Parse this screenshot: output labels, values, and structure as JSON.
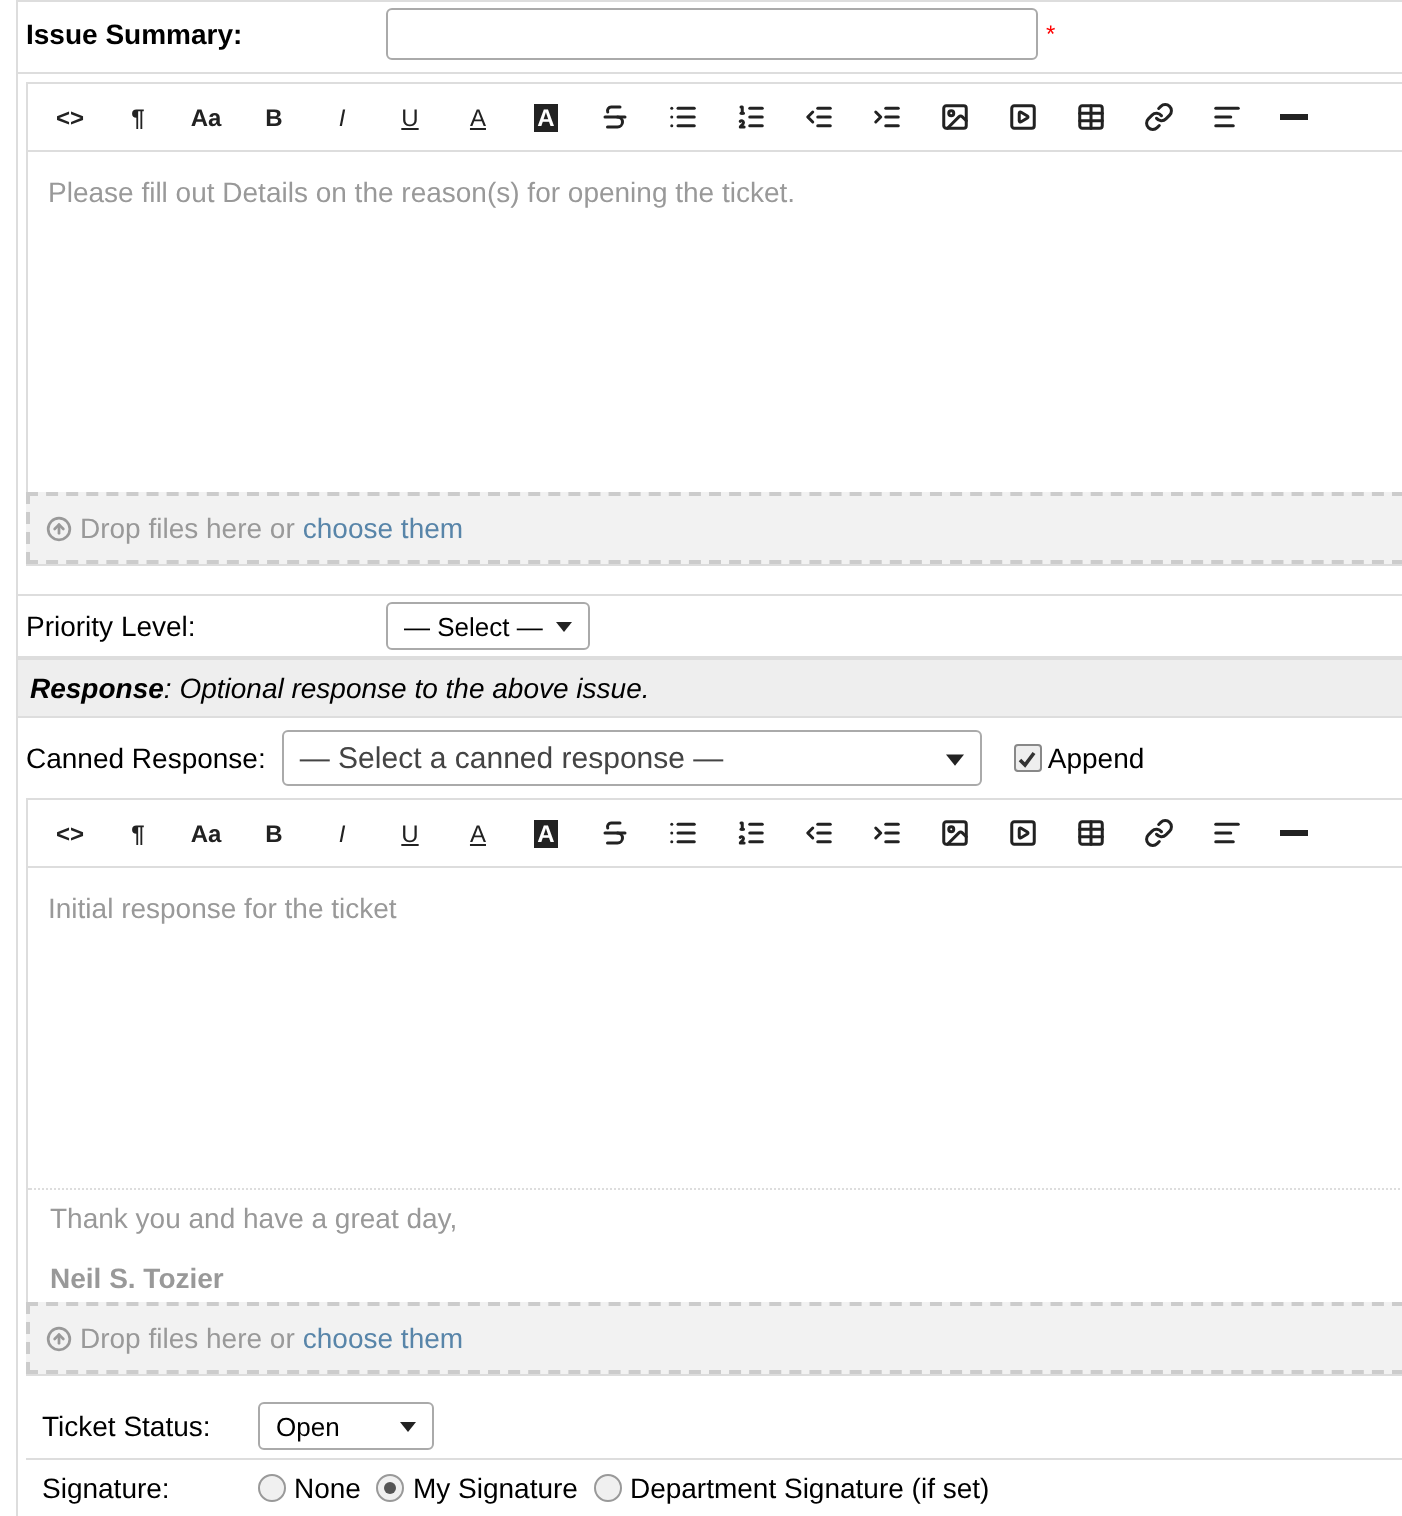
{
  "issue_summary": {
    "label": "Issue Summary:",
    "required_mark": "*"
  },
  "editors": [
    {
      "toolbar": [
        {
          "kind": "code",
          "label": "<>"
        },
        {
          "kind": "text",
          "label": "¶"
        },
        {
          "kind": "text",
          "label": "Aa"
        },
        {
          "kind": "bold",
          "label": "B"
        },
        {
          "kind": "italic",
          "label": "I"
        },
        {
          "kind": "underline",
          "label": "U"
        },
        {
          "kind": "color",
          "label": "A"
        },
        {
          "kind": "bg",
          "label": "A"
        },
        {
          "kind": "strike"
        },
        {
          "kind": "ul"
        },
        {
          "kind": "ol"
        },
        {
          "kind": "outdent"
        },
        {
          "kind": "indent"
        },
        {
          "kind": "image"
        },
        {
          "kind": "video"
        },
        {
          "kind": "table"
        },
        {
          "kind": "link"
        },
        {
          "kind": "align"
        },
        {
          "kind": "rule"
        }
      ],
      "placeholder": "Please fill out Details on the reason(s) for opening the ticket.",
      "drop_text": "Drop files here or",
      "drop_link": "choose them"
    },
    {
      "toolbar": [
        {
          "kind": "code",
          "label": "<>"
        },
        {
          "kind": "text",
          "label": "¶"
        },
        {
          "kind": "text",
          "label": "Aa"
        },
        {
          "kind": "bold",
          "label": "B"
        },
        {
          "kind": "italic",
          "label": "I"
        },
        {
          "kind": "underline",
          "label": "U"
        },
        {
          "kind": "color",
          "label": "A"
        },
        {
          "kind": "bg",
          "label": "A"
        },
        {
          "kind": "strike"
        },
        {
          "kind": "ul"
        },
        {
          "kind": "ol"
        },
        {
          "kind": "outdent"
        },
        {
          "kind": "indent"
        },
        {
          "kind": "image"
        },
        {
          "kind": "video"
        },
        {
          "kind": "table"
        },
        {
          "kind": "link"
        },
        {
          "kind": "align"
        },
        {
          "kind": "rule"
        }
      ],
      "placeholder": "Initial response for the ticket",
      "signature": [
        "Thank you and have a great day,",
        "Neil S. Tozier"
      ],
      "drop_text": "Drop files here or",
      "drop_link": "choose them"
    }
  ],
  "priority": {
    "label": "Priority Level:",
    "value": "— Select —"
  },
  "response_header": "**Response**: Optional response to the above issue.",
  "canned": {
    "label": "Canned Response:",
    "value": "— Select a canned response —",
    "append_label": "Append",
    "append_checked": true
  },
  "ticket_status": {
    "label": "Ticket Status:",
    "value": "Open"
  },
  "signature": {
    "label": "Signature:",
    "options": [
      {
        "label": "None",
        "selected": false
      },
      {
        "label": "My Signature",
        "selected": true
      },
      {
        "label": "Department Signature (if set)",
        "selected": false
      }
    ]
  }
}
